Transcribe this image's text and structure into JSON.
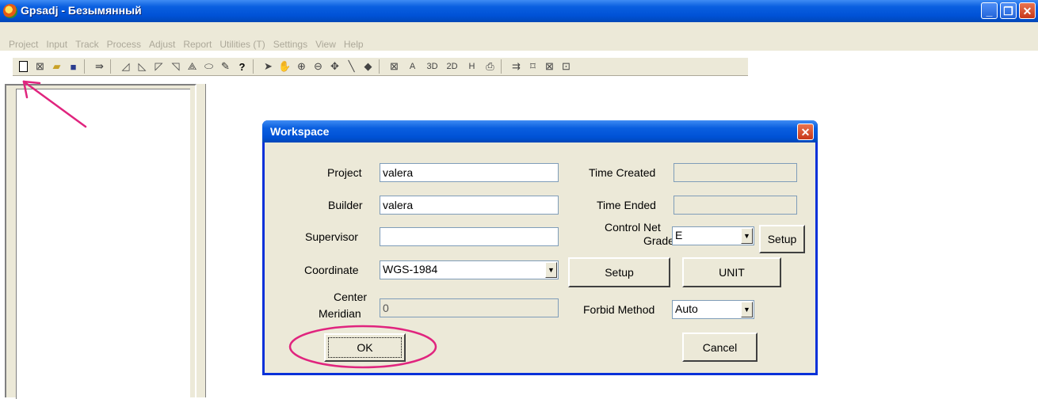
{
  "window": {
    "title": "Gpsadj - Безымянный",
    "minimize": "_",
    "maximize": "❐",
    "close": "✕"
  },
  "menu": [
    "Project",
    "Input",
    "Track",
    "Process",
    "Adjust",
    "Report",
    "Utilities (T)",
    "Settings",
    "View",
    "Help"
  ],
  "toolbar": {
    "labels": [
      "A",
      "3D",
      "2D",
      "H"
    ]
  },
  "dialog": {
    "title": "Workspace",
    "close": "✕",
    "project_label": "Project",
    "project_value": "valera",
    "builder_label": "Builder",
    "builder_value": "valera",
    "supervisor_label": "Supervisor",
    "supervisor_value": "",
    "coordinate_label": "Coordinate",
    "coordinate_value": "WGS-1984",
    "center_meridian_label_1": "Center",
    "center_meridian_label_2": "Meridian",
    "center_meridian_value": "0",
    "time_created_label": "Time Created",
    "time_created_value": "",
    "time_ended_label": "Time Ended",
    "time_ended_value": "",
    "control_net_grade_label_1": "Control Net",
    "control_net_grade_label_2": "Grade",
    "control_net_grade_value": "E",
    "grade_setup_button": "Setup",
    "coordinate_setup_button": "Setup",
    "unit_button": "UNIT",
    "forbid_method_label": "Forbid Method",
    "forbid_method_value": "Auto",
    "ok_button": "OK",
    "cancel_button": "Cancel"
  },
  "colors": {
    "titlebar_blue": "#0052d6",
    "annotation_magenta": "#e0247e",
    "dialog_face": "#ece9d8"
  }
}
